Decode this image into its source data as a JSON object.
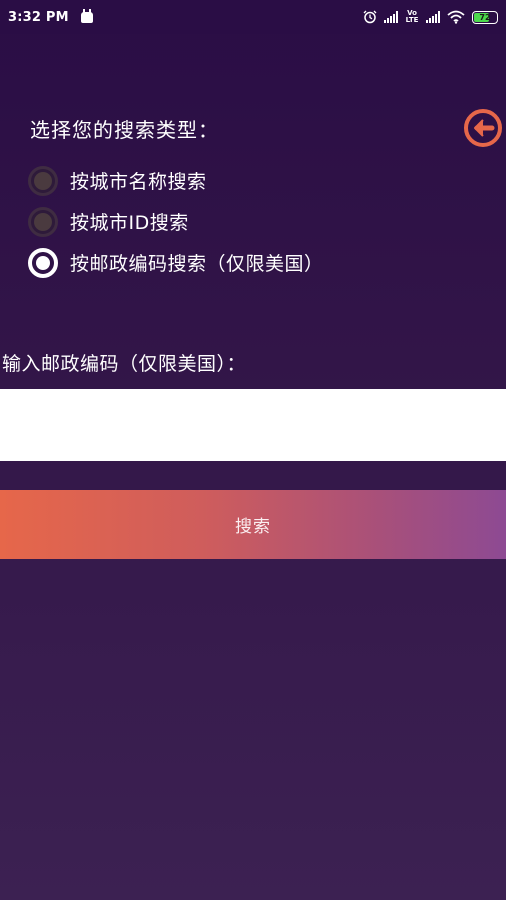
{
  "status_bar": {
    "time": "3:32 PM",
    "volte": "Vo LTE",
    "battery_level": "72",
    "battery_fraction": 0.72,
    "icons": [
      "android-icon",
      "alarm-icon",
      "signal-icon",
      "wifi-icon",
      "battery-icon"
    ]
  },
  "search_type": {
    "title": "选择您的搜索类型：",
    "options": [
      {
        "label": "按城市名称搜索",
        "selected": false
      },
      {
        "label": "按城市ID搜索",
        "selected": false
      },
      {
        "label": "按邮政编码搜索（仅限美国）",
        "selected": true
      }
    ]
  },
  "zip": {
    "label": "输入邮政编码（仅限美国）：",
    "value": "",
    "placeholder": ""
  },
  "search_button": {
    "label": "搜索"
  },
  "back_button": {
    "icon": "back-arrow-icon"
  },
  "colors": {
    "background_top": "#2a0d45",
    "background_bottom": "#3c2152",
    "accent": "#e6674a",
    "button_gradient_start": "#e6674a",
    "button_gradient_end": "#8d4a93"
  }
}
